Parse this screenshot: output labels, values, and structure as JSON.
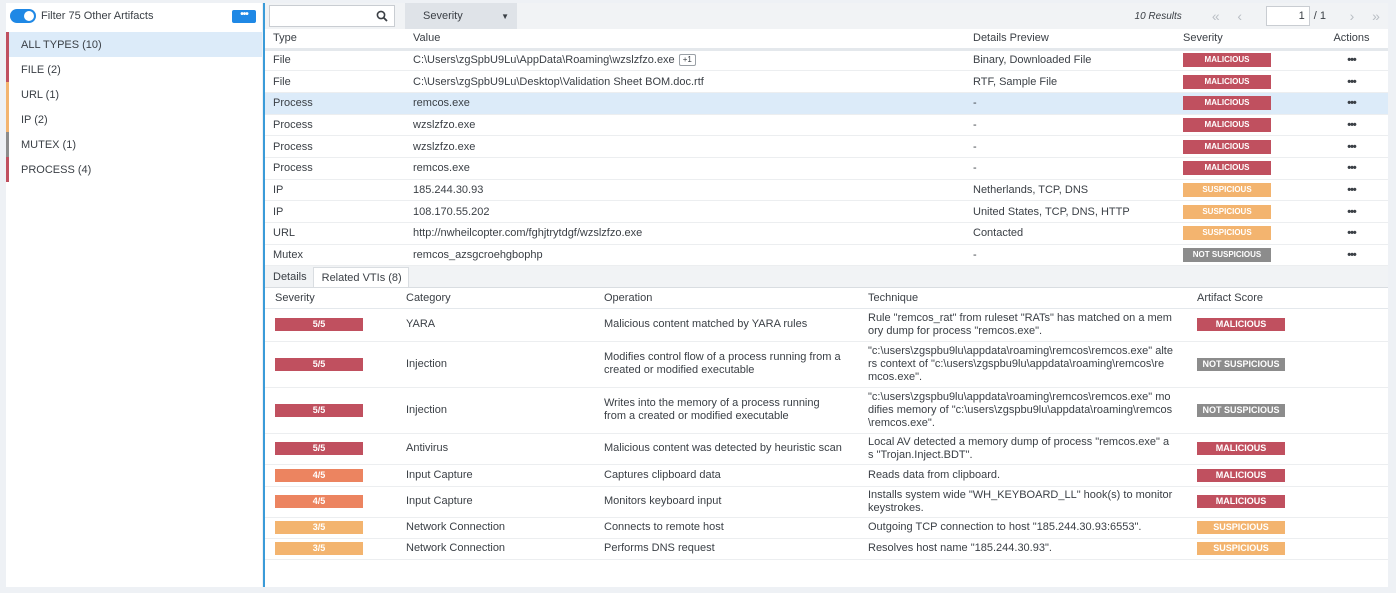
{
  "colors": {
    "accent": "#1f88e5",
    "malicious": "#c0505f",
    "suspicious": "#f3b46f",
    "not_suspicious": "#8c8c8c",
    "score_high": "#c0505f",
    "score_mid": "#ec8460",
    "score_low": "#f3b46f",
    "sidebar_malicious": "#c0505f",
    "sidebar_suspicious": "#f3b46f",
    "sidebar_neutral": "#8c8c8c"
  },
  "sidebar": {
    "filter_label": "Filter 75 Other Artifacts",
    "more_label": "•••",
    "types": [
      {
        "label": "ALL TYPES (10)",
        "color": "#c0505f",
        "active": true
      },
      {
        "label": "FILE (2)",
        "color": "#c0505f",
        "active": false
      },
      {
        "label": "URL (1)",
        "color": "#f3b46f",
        "active": false
      },
      {
        "label": "IP (2)",
        "color": "#f3b46f",
        "active": false
      },
      {
        "label": "MUTEX (1)",
        "color": "#8c8c8c",
        "active": false
      },
      {
        "label": "PROCESS (4)",
        "color": "#c0505f",
        "active": false
      }
    ]
  },
  "toolbar": {
    "search_placeholder": "",
    "severity_label": "Severity",
    "results_label": "10 Results",
    "page_current": "1",
    "page_total": "/ 1"
  },
  "artifacts": {
    "columns": [
      "Type",
      "Value",
      "Details Preview",
      "Severity",
      "Actions"
    ],
    "rows": [
      {
        "type": "File",
        "value": "C:\\Users\\zgSpbU9Lu\\AppData\\Roaming\\wzslzfzo.exe",
        "badge": "+1",
        "details": "Binary, Downloaded File",
        "severity": "MALICIOUS",
        "sev_color": "#c0505f",
        "selected": false
      },
      {
        "type": "File",
        "value": "C:\\Users\\zgSpbU9Lu\\Desktop\\Validation Sheet BOM.doc.rtf",
        "badge": "",
        "details": "RTF, Sample File",
        "severity": "MALICIOUS",
        "sev_color": "#c0505f",
        "selected": false
      },
      {
        "type": "Process",
        "value": "remcos.exe",
        "badge": "",
        "details": "-",
        "severity": "MALICIOUS",
        "sev_color": "#c0505f",
        "selected": true
      },
      {
        "type": "Process",
        "value": "wzslzfzo.exe",
        "badge": "",
        "details": "-",
        "severity": "MALICIOUS",
        "sev_color": "#c0505f",
        "selected": false
      },
      {
        "type": "Process",
        "value": "wzslzfzo.exe",
        "badge": "",
        "details": "-",
        "severity": "MALICIOUS",
        "sev_color": "#c0505f",
        "selected": false
      },
      {
        "type": "Process",
        "value": "remcos.exe",
        "badge": "",
        "details": "-",
        "severity": "MALICIOUS",
        "sev_color": "#c0505f",
        "selected": false
      },
      {
        "type": "IP",
        "value": "185.244.30.93",
        "badge": "",
        "details": "Netherlands, TCP, DNS",
        "severity": "SUSPICIOUS",
        "sev_color": "#f3b46f",
        "selected": false
      },
      {
        "type": "IP",
        "value": "108.170.55.202",
        "badge": "",
        "details": "United States, TCP, DNS, HTTP",
        "severity": "SUSPICIOUS",
        "sev_color": "#f3b46f",
        "selected": false
      },
      {
        "type": "URL",
        "value": "http://nwheilcopter.com/fghjtrytdgf/wzslzfzo.exe",
        "badge": "",
        "details": "Contacted",
        "severity": "SUSPICIOUS",
        "sev_color": "#f3b46f",
        "selected": false
      },
      {
        "type": "Mutex",
        "value": "remcos_azsgcroehgbophp",
        "badge": "",
        "details": "-",
        "severity": "NOT SUSPICIOUS",
        "sev_color": "#8c8c8c",
        "selected": false
      }
    ]
  },
  "tabs": [
    {
      "label": "Details",
      "active": false
    },
    {
      "label": "Related VTIs (8)",
      "active": true
    }
  ],
  "vtis": {
    "columns": [
      "Severity",
      "Category",
      "Operation",
      "Technique",
      "Artifact Score"
    ],
    "rows": [
      {
        "score": "5/5",
        "score_color": "#c0505f",
        "category": "YARA",
        "operation": "Malicious content matched by YARA rules",
        "technique": "Rule \"remcos_rat\" from ruleset \"RATs\" has matched on a memory dump for process \"remcos.exe\".",
        "artifact_score": "MALICIOUS",
        "as_color": "#c0505f",
        "height": 33
      },
      {
        "score": "5/5",
        "score_color": "#c0505f",
        "category": "Injection",
        "operation": "Modifies control flow of a process running from a created or modified executable",
        "technique": "\"c:\\users\\zgspbu9lu\\appdata\\roaming\\remcos\\remcos.exe\" alters context of \"c:\\users\\zgspbu9lu\\appdata\\roaming\\remcos\\remcos.exe\".",
        "artifact_score": "NOT SUSPICIOUS",
        "as_color": "#8c8c8c",
        "height": 46
      },
      {
        "score": "5/5",
        "score_color": "#c0505f",
        "category": "Injection",
        "operation": "Writes into the memory of a process running from a created or modified executable",
        "technique": "\"c:\\users\\zgspbu9lu\\appdata\\roaming\\remcos\\remcos.exe\" modifies memory of \"c:\\users\\zgspbu9lu\\appdata\\roaming\\remcos\\remcos.exe\".",
        "artifact_score": "NOT SUSPICIOUS",
        "as_color": "#8c8c8c",
        "height": 46
      },
      {
        "score": "5/5",
        "score_color": "#c0505f",
        "category": "Antivirus",
        "operation": "Malicious content was detected by heuristic scan",
        "technique": "Local AV detected a memory dump of process \"remcos.exe\" as \"Trojan.Inject.BDT\".",
        "artifact_score": "MALICIOUS",
        "as_color": "#c0505f",
        "height": 31
      },
      {
        "score": "4/5",
        "score_color": "#ec8460",
        "category": "Input Capture",
        "operation": "Captures clipboard data",
        "technique": "Reads data from clipboard.",
        "artifact_score": "MALICIOUS",
        "as_color": "#c0505f",
        "height": 22
      },
      {
        "score": "4/5",
        "score_color": "#ec8460",
        "category": "Input Capture",
        "operation": "Monitors keyboard input",
        "technique": "Installs system wide \"WH_KEYBOARD_LL\" hook(s) to monitor keystrokes.",
        "artifact_score": "MALICIOUS",
        "as_color": "#c0505f",
        "height": 31
      },
      {
        "score": "3/5",
        "score_color": "#f3b46f",
        "category": "Network Connection",
        "operation": "Connects to remote host",
        "technique": "Outgoing TCP connection to host \"185.244.30.93:6553\".",
        "artifact_score": "SUSPICIOUS",
        "as_color": "#f3b46f",
        "height": 21
      },
      {
        "score": "3/5",
        "score_color": "#f3b46f",
        "category": "Network Connection",
        "operation": "Performs DNS request",
        "technique": "Resolves host name \"185.244.30.93\".",
        "artifact_score": "SUSPICIOUS",
        "as_color": "#f3b46f",
        "height": 21
      }
    ]
  }
}
